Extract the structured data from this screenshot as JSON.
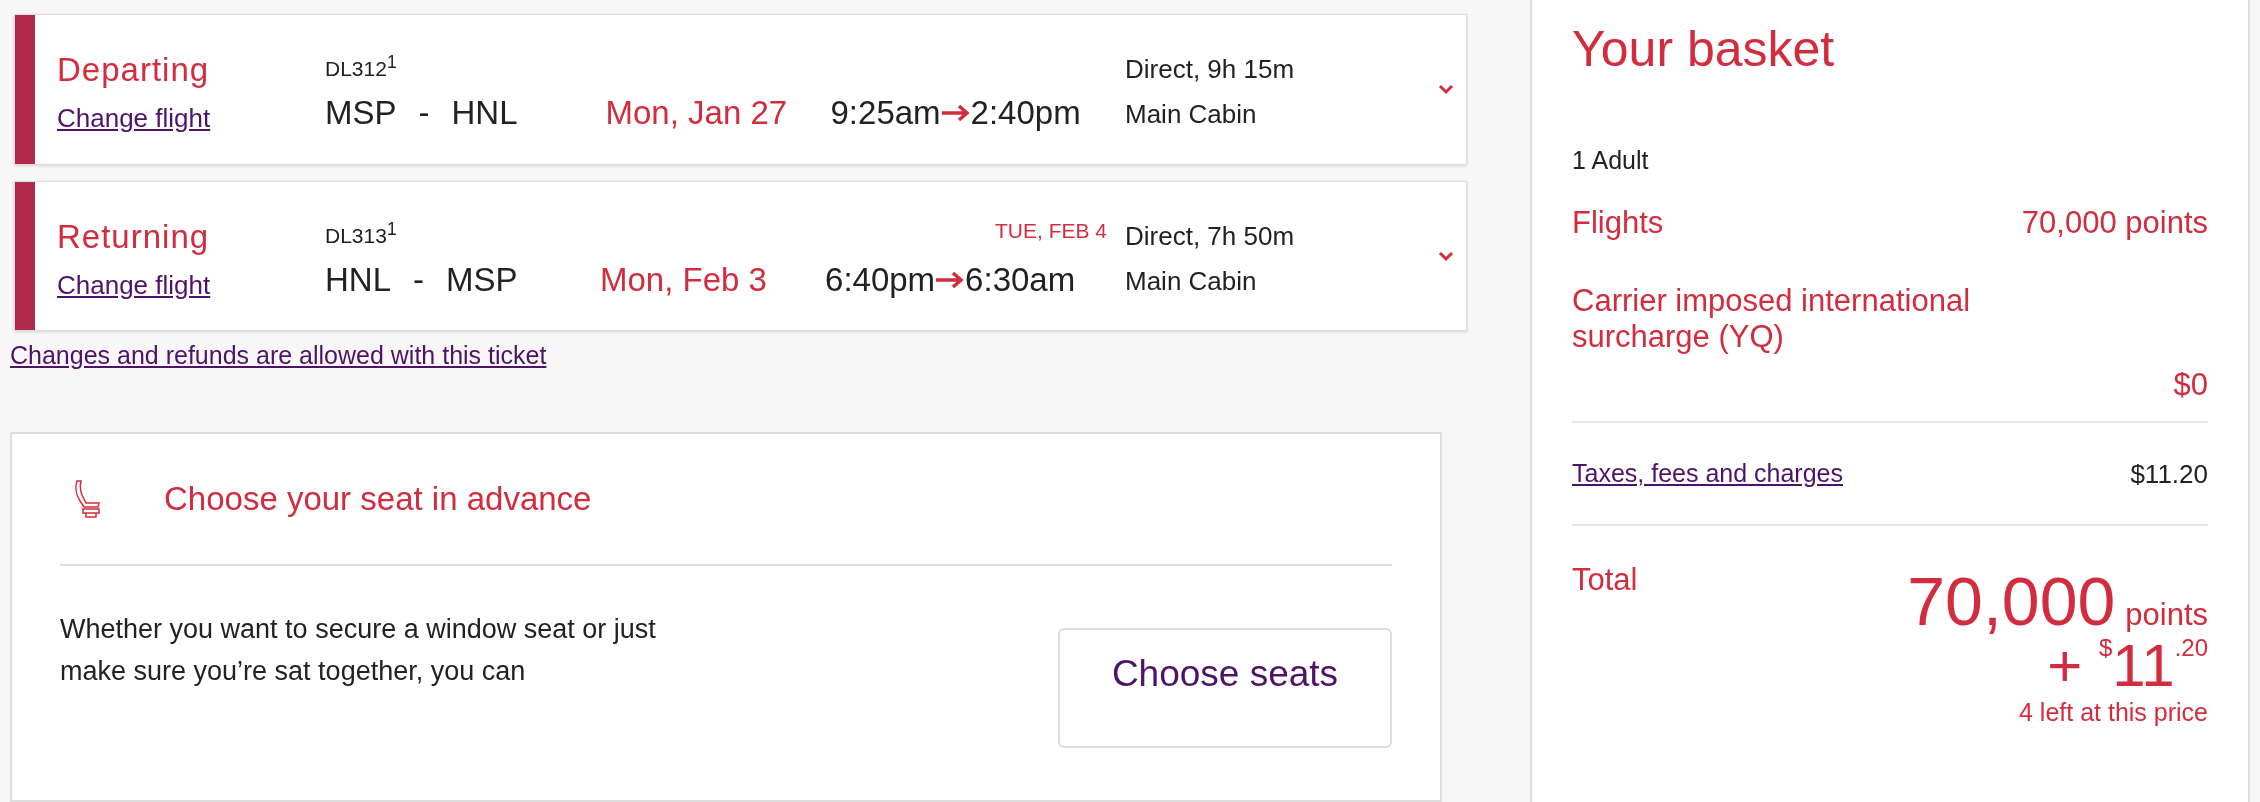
{
  "flights": [
    {
      "label": "Departing",
      "change_link": "Change flight",
      "flight_number": "DL312$^{1}$",
      "origin": "MSP",
      "separator": "-",
      "destination": "HNL",
      "date": "Mon, Jan 27",
      "depart_time": "9:25am",
      "arrive_time": "2:40pm",
      "duration": "Direct, 9h 15m",
      "cabin": "Main Cabin",
      "expanded": false
    },
    {
      "label": "Returning",
      "change_link": "Change flight",
      "flight_number": "DL313$^{1}$",
      "origin": "HNL",
      "separator": "-",
      "destination": "MSP",
      "date": "Mon, Feb 3",
      "depart_time": "6:40pm",
      "arrive_time": "6:30am",
      "arrival_note": "TUE, FEB 4",
      "duration": "Direct, 7h 50m",
      "cabin": "Main Cabin",
      "expanded": false
    }
  ],
  "refund_link": "Changes and refunds are allowed with this ticket",
  "seat_card": {
    "title": "Choose your seat in advance",
    "text": "Whether you want to secure a window seat or just make sure you’re sat together, you can",
    "button": "Choose seats"
  },
  "basket": {
    "title": "Your basket",
    "passengers": "1 Adult",
    "flights": {
      "label": "Flights",
      "value": "70,000 points"
    },
    "surcharge": {
      "label": "Carrier imposed international surcharge (YQ)",
      "value": "$0"
    },
    "taxes": {
      "label": "Taxes, fees and charges",
      "value": "$11.20"
    },
    "total": {
      "label": "Total",
      "points": "70,000",
      "points_unit": "points",
      "cash": "+ $^{$}$11$^{.20}$",
      "availability": "4 left at this price"
    }
  }
}
